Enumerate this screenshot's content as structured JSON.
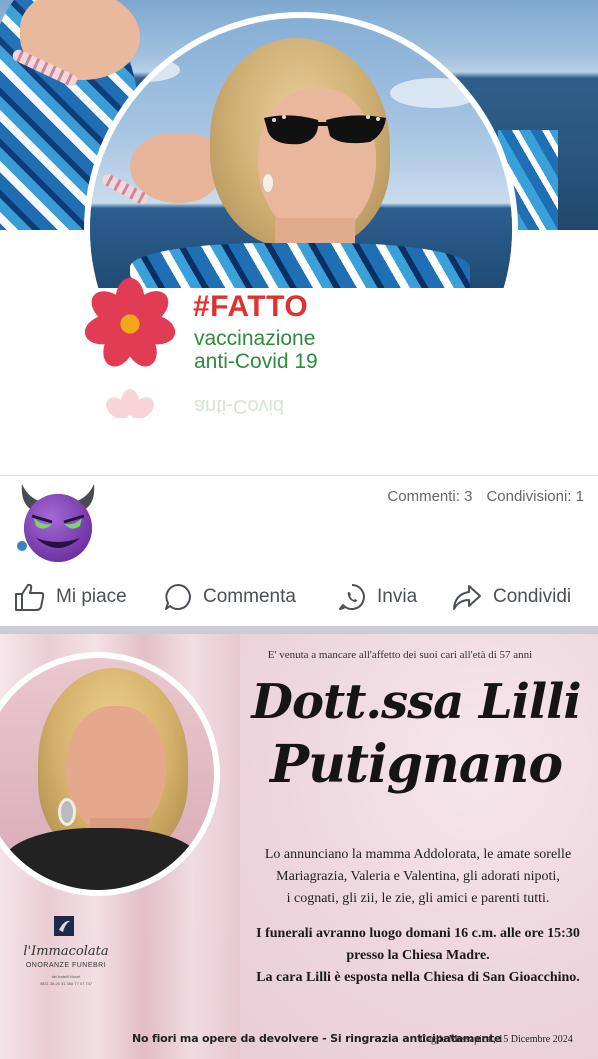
{
  "profile": {
    "badge_title": "#FATTO",
    "badge_line1": "vaccinazione",
    "badge_line2": "anti-Covid 19",
    "badge_reflection": "anti-Covid"
  },
  "reactions": {
    "emoji_icon": "smiling-devil-icon"
  },
  "counts": {
    "comments": "Commenti: 3",
    "shares": "Condivisioni: 1"
  },
  "actions": {
    "like": "Mi piace",
    "comment": "Commenta",
    "send": "Invia",
    "share": "Condividi"
  },
  "notice": {
    "intro": "E' venuta a mancare all'affetto dei suoi cari all'età di 57 anni",
    "name_line1": "Dott.ssa Lilli",
    "name_line2": "Putignano",
    "body_lines": [
      "Lo annunciano la mamma Addolorata, le amate sorelle",
      "Mariagrazia, Valeria e Valentina, gli adorati nipoti,",
      "i cognati, gli zii, le zie, gli amici e parenti tutti."
    ],
    "funeral_lines": [
      "I funerali avranno luogo domani 16 c.m. alle ore 15:30",
      "presso la Chiesa Madre.",
      "La cara Lilli è esposta nella Chiesa di San Gioacchino."
    ],
    "footer": "No fiori ma opere da devolvere - Si ringrazia anticipatamente",
    "place_date": "Ceglie Messapica , 15 Dicembre 2024",
    "logo_script": "l'Immacolata",
    "logo_sub": "ONORANZE FUNEBRI",
    "logo_tiny": "dei fratelli Nocet",
    "logo_phones": "0831 38 25 31     360 77 07 747"
  },
  "colors": {
    "fatto_red": "#e0312f",
    "vax_green": "#2e8c3c",
    "action_gray": "#4b4f56",
    "count_gray": "#65676b",
    "devil_purple": "#7e3fb0"
  }
}
